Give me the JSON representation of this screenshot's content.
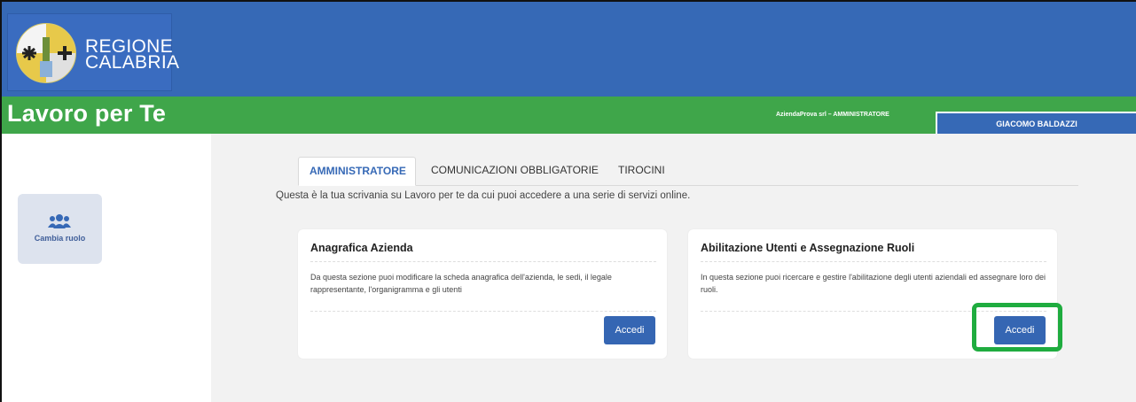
{
  "header": {
    "logo_line1": "REGIONE",
    "logo_line2": "CALABRIA",
    "app_title": "Lavoro per Te",
    "org_info": "AziendaProva srl – AMMINISTRATORE",
    "user_name": "GIACOMO BALDAZZI"
  },
  "sidebar": {
    "change_role_label": "Cambia ruolo"
  },
  "tabs": [
    {
      "label": "AMMINISTRATORE",
      "active": true
    },
    {
      "label": "COMUNICAZIONI OBBLIGATORIE",
      "active": false
    },
    {
      "label": "TIROCINI",
      "active": false
    }
  ],
  "intro": "Questa è la tua scrivania su Lavoro per te da cui puoi accedere a una serie di servizi online.",
  "cards": [
    {
      "title": "Anagrafica Azienda",
      "text": "Da questa sezione puoi modificare la scheda anagrafica dell'azienda, le sedi, il legale rappresentante, l'organigramma e gli utenti",
      "button": "Accedi"
    },
    {
      "title": "Abilitazione Utenti e Assegnazione Ruoli",
      "text": "In questa sezione puoi ricercare e gestire l'abilitazione degli utenti aziendali ed assegnare loro dei ruoli.",
      "button": "Accedi"
    }
  ],
  "colors": {
    "header_blue": "#3669b6",
    "header_green": "#3fa64a",
    "highlight_green": "#1fac3f",
    "button_blue": "#3566b3"
  }
}
